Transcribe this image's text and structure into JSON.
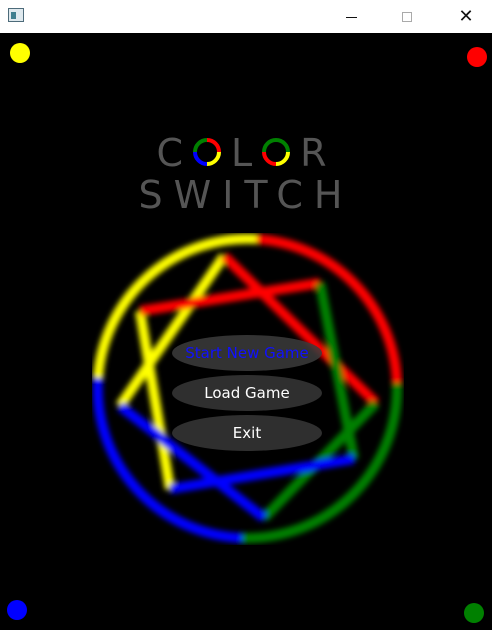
{
  "window": {
    "minimize_icon": "minimize-icon",
    "maximize_icon": "maximize-icon",
    "close_icon": "close-icon"
  },
  "colors": {
    "background": "#000000",
    "title": "#555555",
    "yellow": "#ffff00",
    "red": "#ff0000",
    "blue": "#0000ff",
    "green": "#008000",
    "button_bg": "#2f2f2f",
    "selected_text": "#1010ff",
    "button_text": "#ffffff"
  },
  "title": {
    "line1_letters": [
      "C",
      "L",
      "R"
    ],
    "line2": "SWITCH"
  },
  "menu": {
    "start_new_game": "Start New Game",
    "load_game": "Load Game",
    "exit": "Exit"
  }
}
